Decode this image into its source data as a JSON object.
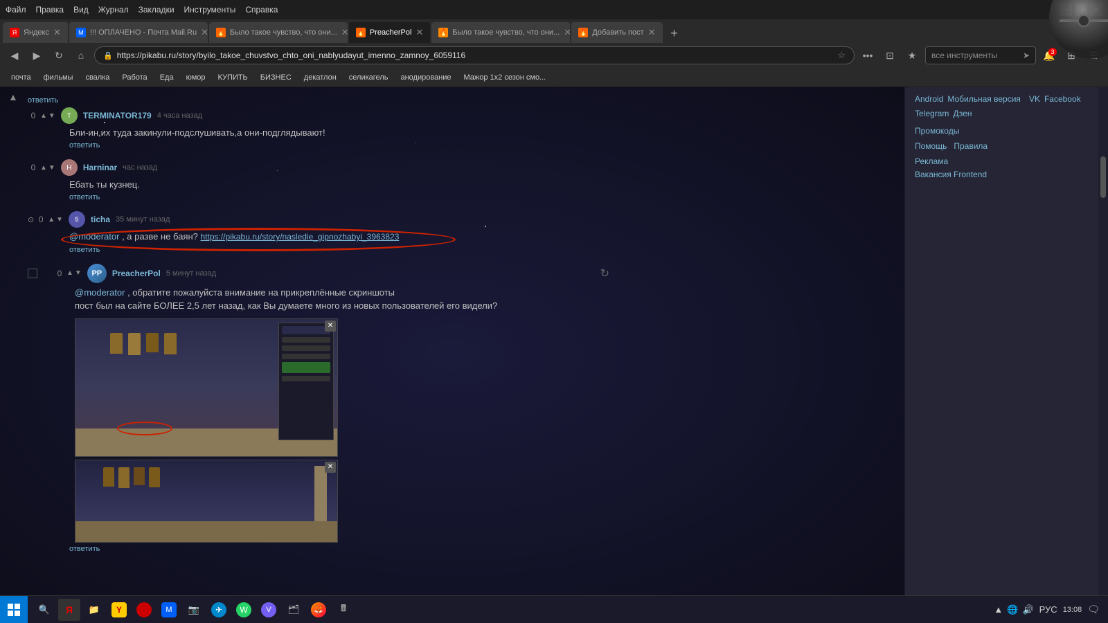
{
  "browser": {
    "title": "Firefox",
    "menu": [
      "Файл",
      "Правка",
      "Вид",
      "Журнал",
      "Закладки",
      "Инструменты",
      "Справка"
    ],
    "tabs": [
      {
        "label": "Яндекс",
        "favicon": "Я",
        "active": false
      },
      {
        "label": "!!! ОПЛАЧЕНО - Почта Mail.Ru",
        "favicon": "М",
        "active": false
      },
      {
        "label": "Было такое чувство, что они...",
        "favicon": "🔥",
        "active": false
      },
      {
        "label": "PreacherPol",
        "favicon": "🔥",
        "active": true
      },
      {
        "label": "Было такое чувство, что они...",
        "favicon": "🔥",
        "active": false
      },
      {
        "label": "Добавить пост",
        "favicon": "🔥",
        "active": false
      }
    ],
    "address": "https://pikabu.ru/story/byilo_takoe_chuvstvo_chto_oni_nablyudayut_imenno_zamnoy_6059116",
    "search_placeholder": "все инструменты"
  },
  "bookmarks": [
    "почта",
    "фильмы",
    "свалка",
    "Работа",
    "Еда",
    "юмор",
    "КУПИТЬ",
    "БИЗНЕС",
    "декатлон",
    "селикагель",
    "анодирование",
    "Мажор 1х2 сезон смо..."
  ],
  "comments": [
    {
      "id": "terminator",
      "votes": "0",
      "username": "TERMINATOR179",
      "timestamp": "4 часа назад",
      "avatar": "T",
      "text": "Бли-ин,их туда закинули-подслушивать,а они-подглядывают!",
      "reply": "ответить"
    },
    {
      "id": "harninar",
      "votes": "0",
      "username": "Harninar",
      "timestamp": "час назад",
      "avatar": "H",
      "text": "Ебать ты кузнец.",
      "reply": "ответить"
    },
    {
      "id": "ticha",
      "votes": "0",
      "username": "ticha",
      "timestamp": "35 минут назад",
      "avatar": "t",
      "highlighted": true,
      "mention": "@moderator",
      "text_before": "",
      "text_after": ", а разве не баян?",
      "link": "https://pikabu.ru/story/nasledie_gipnozhabyi_3963823",
      "reply": "ответить"
    },
    {
      "id": "preacher",
      "votes": "0",
      "username": "PreacherPol",
      "timestamp": "5 минут назад",
      "avatar": "PP",
      "mention": "@moderator",
      "text_after": ", обратите пожалуйста внимание на прикреплённые скриншоты",
      "text2": "пост был на сайте БОЛЕЕ 2,5 лет назад, как Вы думаете много из новых пользователей его видели?",
      "reply": "ответить"
    }
  ],
  "sidebar": {
    "social_links": [
      "Android",
      "Мобильная версия",
      "VK",
      "Facebook",
      "Telegram",
      "Дзен"
    ],
    "promo_label": "Промокоды",
    "help_links": [
      "Помощь",
      "Правила"
    ],
    "ad_label": "Реклама",
    "vacancy_label": "Вакансия Frontend"
  },
  "taskbar": {
    "time": "13:08",
    "language": "РУС",
    "icons": [
      "⊞",
      "🔍",
      "📁",
      "Y",
      "🔴",
      "📧",
      "📷",
      "📨",
      "📺",
      "🔵",
      "💬",
      "📱",
      "🗂",
      "🦊",
      "🖩"
    ]
  }
}
